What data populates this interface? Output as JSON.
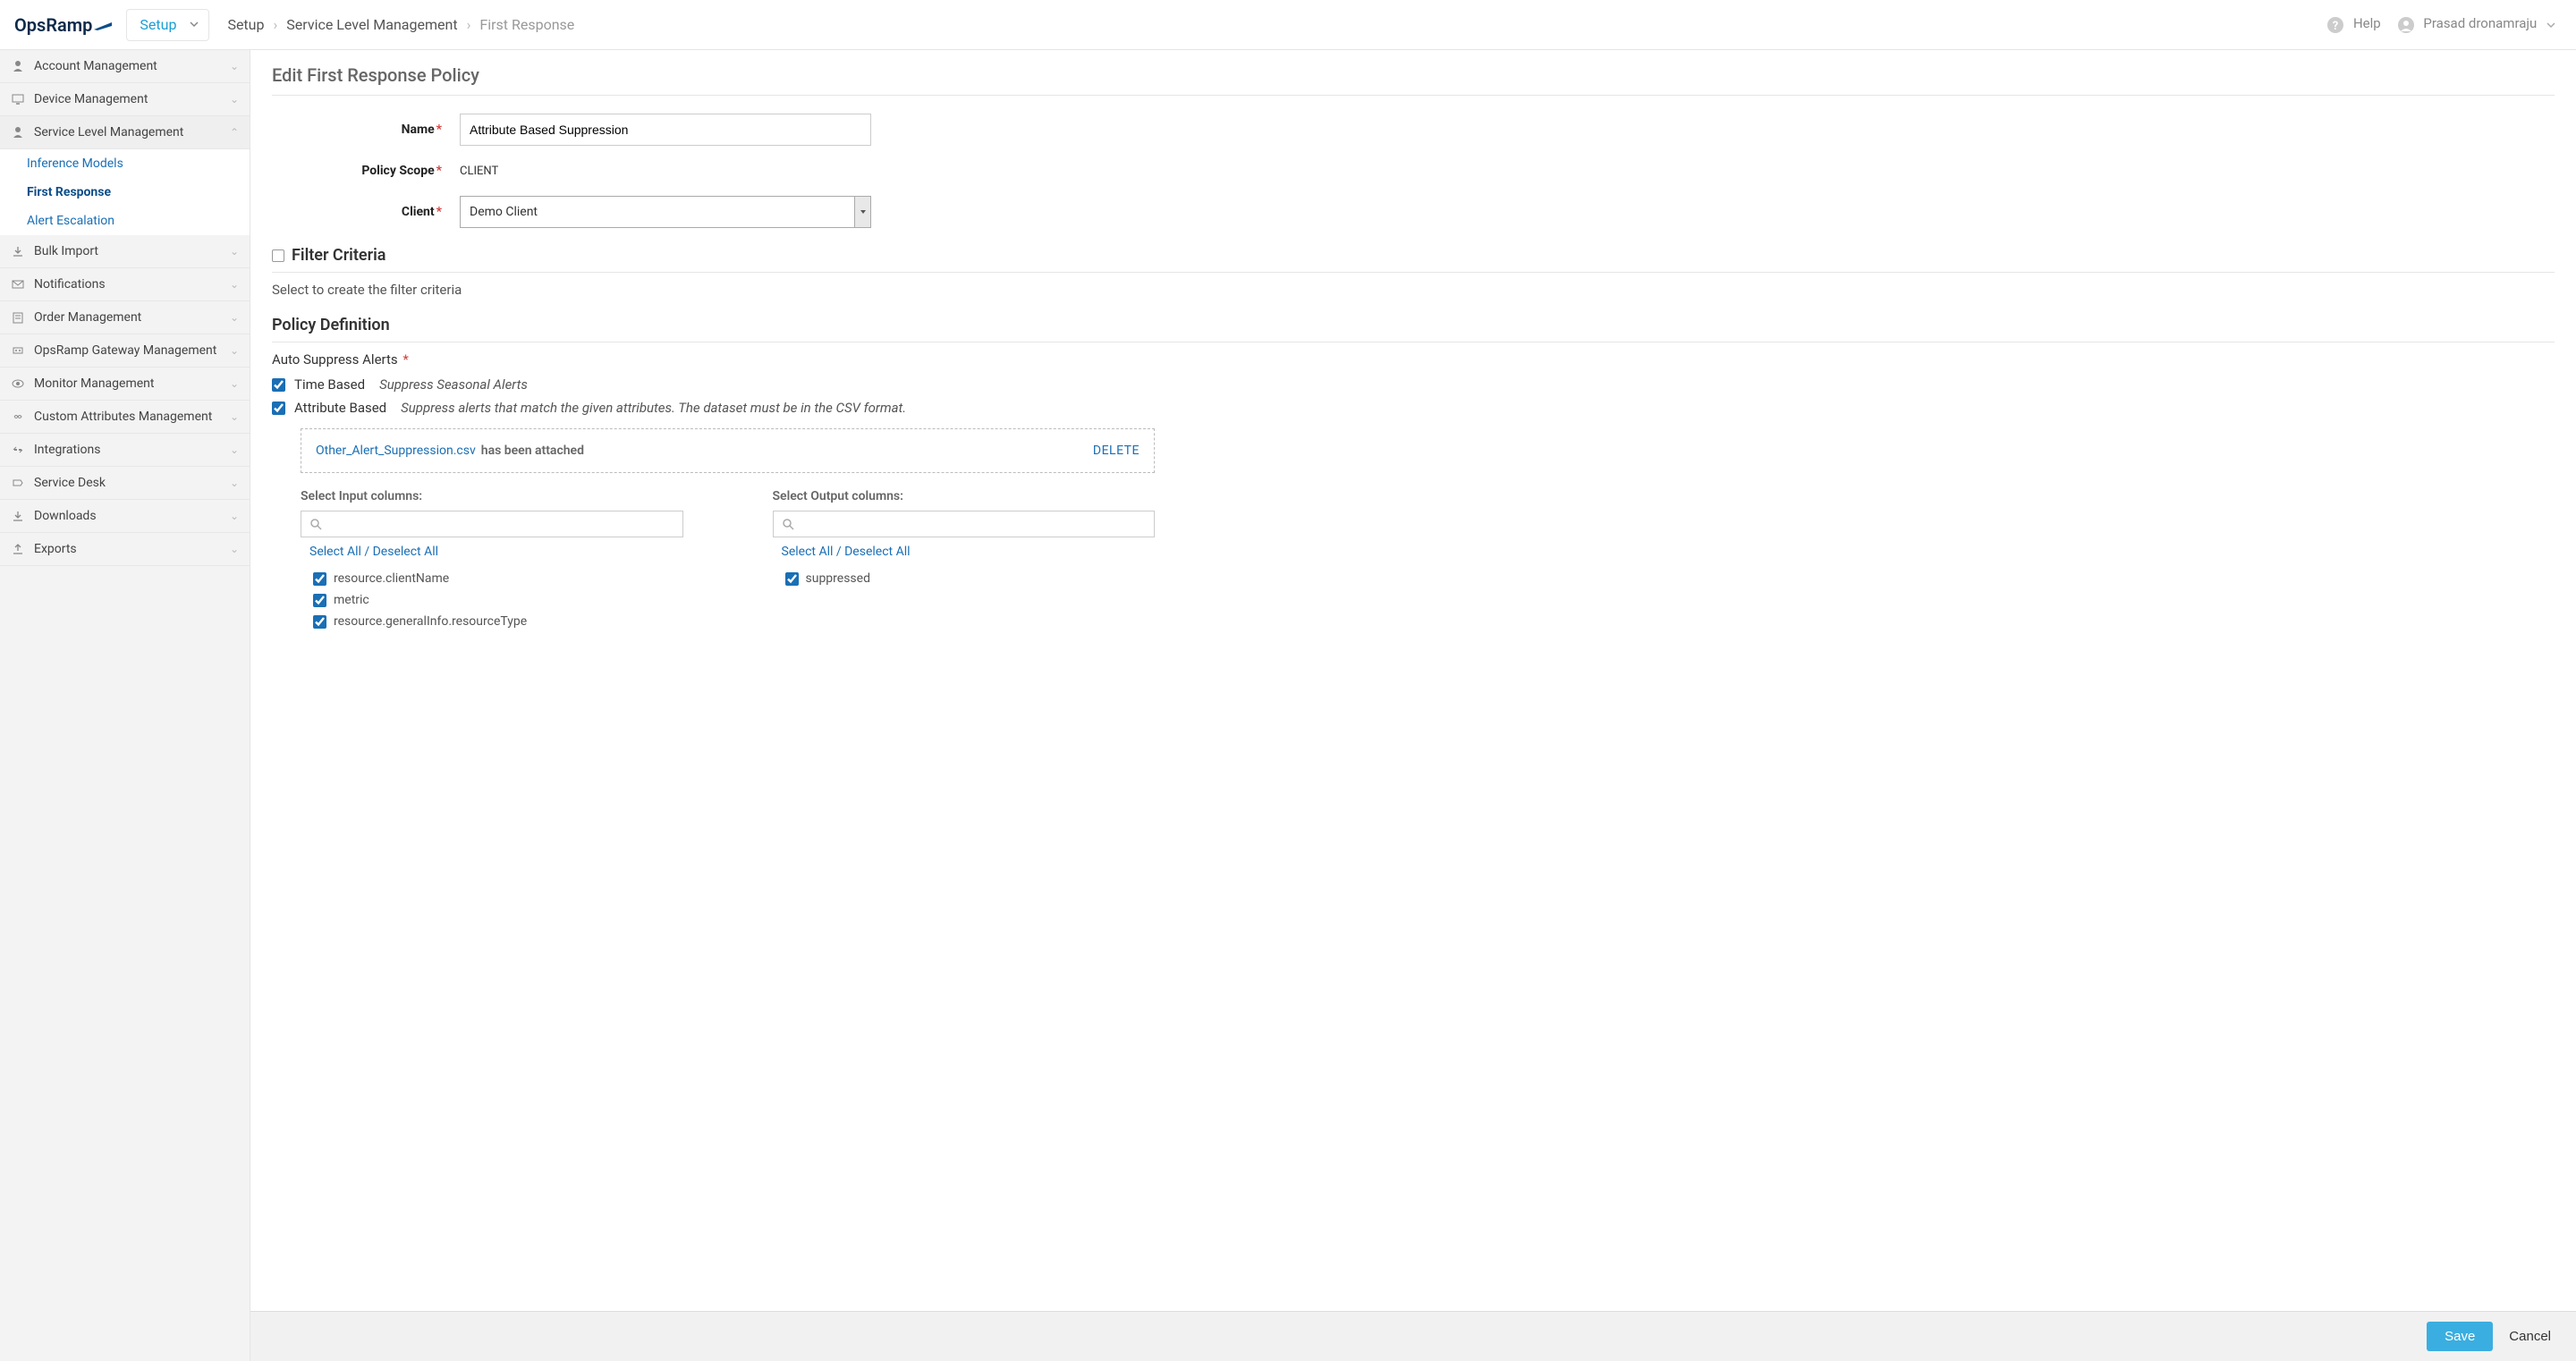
{
  "header": {
    "logo_text": "OpsRamp",
    "dropdown": "Setup",
    "breadcrumb": [
      "Setup",
      "Service Level Management",
      "First Response"
    ],
    "help": "Help",
    "user": "Prasad dronamraju"
  },
  "sidebar": {
    "groups": [
      {
        "label": "Account Management",
        "icon": "person"
      },
      {
        "label": "Device Management",
        "icon": "monitor"
      },
      {
        "label": "Service Level Management",
        "icon": "person",
        "expanded": true,
        "items": [
          {
            "label": "Inference Models"
          },
          {
            "label": "First Response",
            "active": true
          },
          {
            "label": "Alert Escalation"
          }
        ]
      },
      {
        "label": "Bulk Import",
        "icon": "import"
      },
      {
        "label": "Notifications",
        "icon": "mail"
      },
      {
        "label": "Order Management",
        "icon": "clipboard"
      },
      {
        "label": "OpsRamp Gateway Management",
        "icon": "gateway"
      },
      {
        "label": "Monitor Management",
        "icon": "eye"
      },
      {
        "label": "Custom Attributes Management",
        "icon": "infinity"
      },
      {
        "label": "Integrations",
        "icon": "link"
      },
      {
        "label": "Service Desk",
        "icon": "ticket"
      },
      {
        "label": "Downloads",
        "icon": "download"
      },
      {
        "label": "Exports",
        "icon": "export"
      }
    ]
  },
  "page": {
    "title": "Edit First Response Policy",
    "form": {
      "name_label": "Name",
      "name_value": "Attribute Based Suppression",
      "scope_label": "Policy Scope",
      "scope_value": "CLIENT",
      "client_label": "Client",
      "client_value": "Demo Client"
    },
    "filter": {
      "heading": "Filter Criteria",
      "help": "Select to create the filter criteria"
    },
    "policy": {
      "heading": "Policy Definition",
      "auto_suppress_label": "Auto Suppress Alerts",
      "time_based": {
        "label": "Time Based",
        "desc": "Suppress Seasonal Alerts",
        "checked": true
      },
      "attr_based": {
        "label": "Attribute Based",
        "desc": "Suppress alerts that match the given attributes. The dataset must be in the CSV format.",
        "checked": true
      },
      "attachment": {
        "filename": "Other_Alert_Suppression.csv",
        "status": "has been attached",
        "delete": "DELETE"
      },
      "input_cols": {
        "title": "Select Input columns:",
        "toggle": "Select All / Deselect All",
        "items": [
          {
            "label": "resource.clientName",
            "checked": true
          },
          {
            "label": "metric",
            "checked": true
          },
          {
            "label": "resource.generalInfo.resourceType",
            "checked": true
          }
        ]
      },
      "output_cols": {
        "title": "Select Output columns:",
        "toggle": "Select All / Deselect All",
        "items": [
          {
            "label": "suppressed",
            "checked": true
          }
        ]
      }
    },
    "footer": {
      "save": "Save",
      "cancel": "Cancel"
    }
  }
}
